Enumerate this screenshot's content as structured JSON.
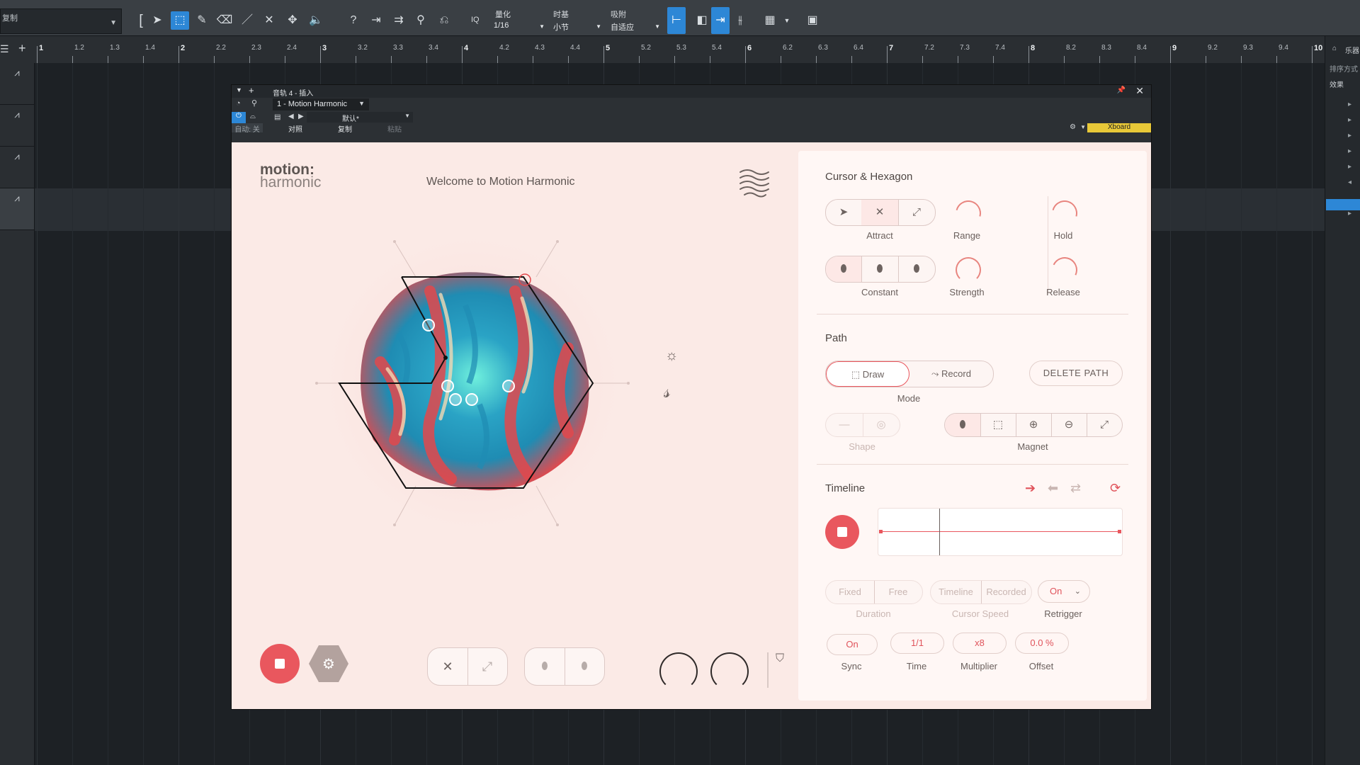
{
  "toolbar": {
    "left_text": "复制",
    "quantize_label": "量化",
    "quantize_value": "1/16",
    "timebase_label": "时基",
    "timebase_value": "小节",
    "snap_label": "吸附",
    "snap_value": "自适应",
    "iq_label": "IQ",
    "help_label": "?"
  },
  "ruler": {
    "labels": [
      "1",
      "1.2",
      "1.3",
      "1.4",
      "2",
      "2.2",
      "2.3",
      "2.4",
      "3",
      "3.2",
      "3.3",
      "3.4",
      "4",
      "4.2",
      "4.3",
      "4.4",
      "5",
      "5.2",
      "5.3",
      "5.4",
      "6",
      "6.2",
      "6.3",
      "6.4",
      "7",
      "7.2",
      "7.3",
      "7.4",
      "8",
      "8.2",
      "8.3",
      "8.4",
      "9",
      "9.2",
      "9.3",
      "9.4",
      "10"
    ]
  },
  "right_panel": {
    "sort_label": "排序方式",
    "effects_label": "效果",
    "top_label": "乐器"
  },
  "plugin_window": {
    "title": "音轨 4 - 插入",
    "preset_name": "1 - Motion Harmonic",
    "preset_default": "默认*",
    "auto_label": "自动: 关",
    "compare_label": "对照",
    "copy_label": "复制",
    "paste_label": "粘贴",
    "xboard_label": "Xboard"
  },
  "motion": {
    "logo_line1": "motion:",
    "logo_line2": "harmonic",
    "welcome": "Welcome to Motion Harmonic"
  },
  "cursor_hex": {
    "title": "Cursor & Hexagon",
    "attract_label": "Attract",
    "range_label": "Range",
    "hold_label": "Hold",
    "constant_label": "Constant",
    "strength_label": "Strength",
    "release_label": "Release"
  },
  "path": {
    "title": "Path",
    "draw_label": "Draw",
    "record_label": "Record",
    "delete_label": "DELETE PATH",
    "mode_label": "Mode",
    "shape_label": "Shape",
    "magnet_label": "Magnet"
  },
  "timeline": {
    "title": "Timeline",
    "fixed_label": "Fixed",
    "free_label": "Free",
    "timeline_label": "Timeline",
    "recorded_label": "Recorded",
    "retrigger_value": "On",
    "duration_label": "Duration",
    "cursor_speed_label": "Cursor Speed",
    "retrigger_label": "Retrigger",
    "sync_value": "On",
    "time_value": "1/1",
    "multiplier_value": "x8",
    "offset_value": "0.0 %",
    "sync_label": "Sync",
    "time_label": "Time",
    "multiplier_label": "Multiplier",
    "offset_label": "Offset"
  },
  "colors": {
    "accent": "#e9575e",
    "panel_bg": "#fbeae6",
    "blob_blue": "#2aa3c5",
    "blob_red": "#e3484c",
    "xboard": "#e8c838",
    "daw_blue": "#2d87d6"
  }
}
